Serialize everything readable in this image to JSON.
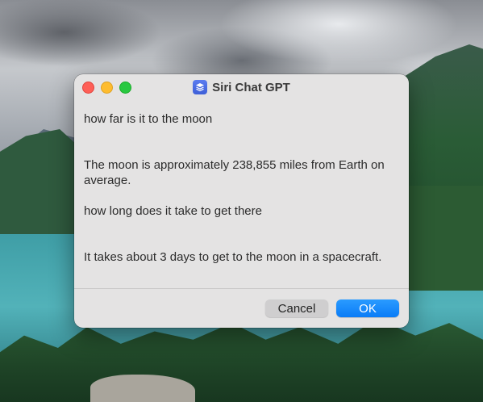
{
  "window": {
    "title": "Siri Chat GPT",
    "app_icon": "layers-icon"
  },
  "conversation": [
    {
      "role": "user",
      "text": "how far is it to the moon"
    },
    {
      "role": "assistant",
      "text": "The moon is approximately 238,855 miles from Earth on average."
    },
    {
      "role": "user",
      "text": "how long does it take to get there"
    },
    {
      "role": "assistant",
      "text": "It takes about 3 days to get to the moon in a spacecraft."
    }
  ],
  "buttons": {
    "cancel_label": "Cancel",
    "ok_label": "OK"
  },
  "colors": {
    "close": "#fe5f57",
    "minimize": "#febc2e",
    "maximize": "#28c840",
    "accent": "#0a7cf7"
  }
}
